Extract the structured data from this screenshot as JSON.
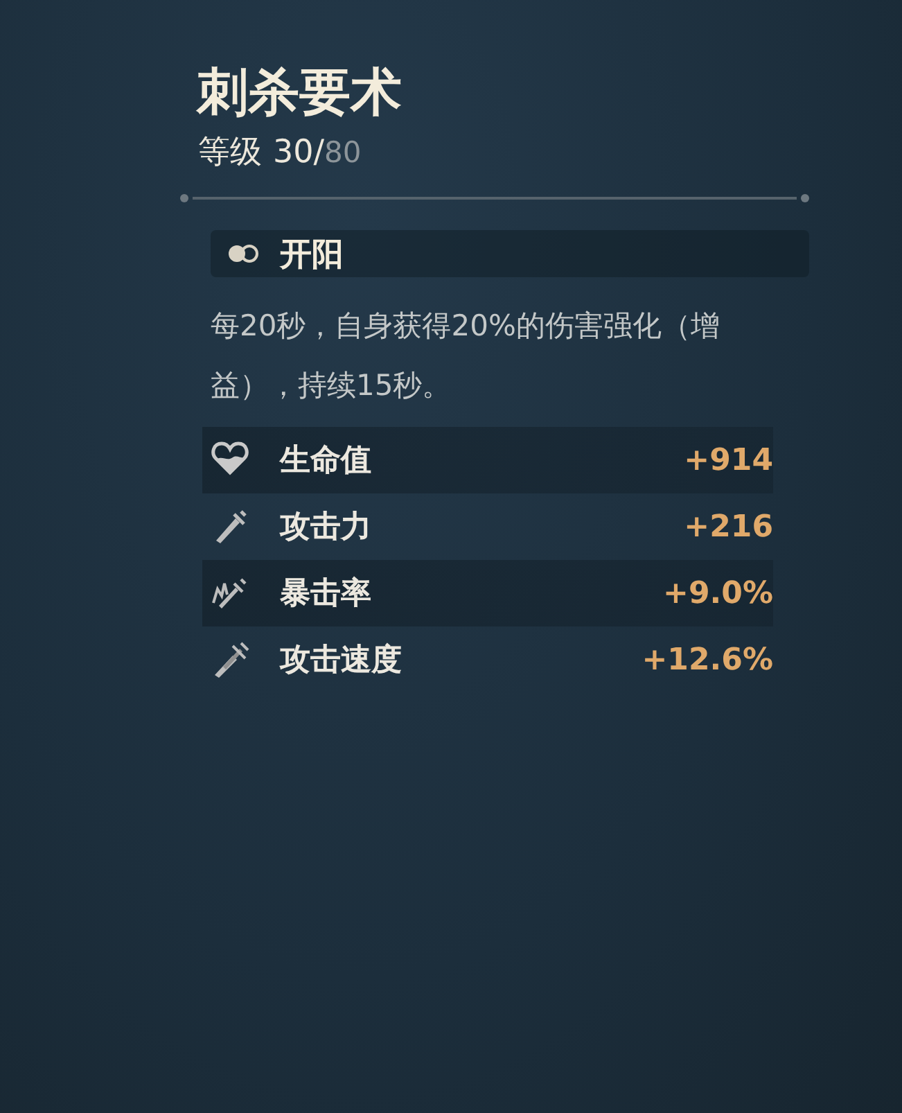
{
  "skill": {
    "title": "刺杀要术",
    "level_label": "等级",
    "level": "30/",
    "level_max": "80"
  },
  "passive": {
    "name": "开阳",
    "description": "每20秒，自身获得20%的伤害强化（增益），持续15秒。"
  },
  "stats": [
    {
      "kind": "health",
      "label": "生命值",
      "value": "+914"
    },
    {
      "kind": "attack",
      "label": "攻击力",
      "value": "+216"
    },
    {
      "kind": "crit",
      "label": "暴击率",
      "value": "+9.0%"
    },
    {
      "kind": "speed",
      "label": "攻击速度",
      "value": "+12.6%"
    }
  ]
}
